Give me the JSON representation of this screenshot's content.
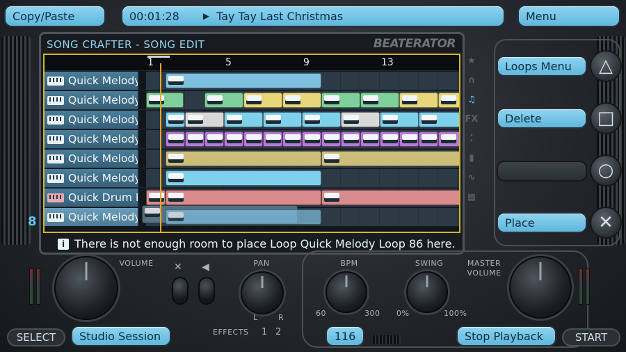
{
  "top_bar": {
    "left_button": "Copy/Paste",
    "time": "00:01:28",
    "play_glyph": "▶",
    "song_title": "Tay Tay Last Christmas",
    "menu_button": "Menu"
  },
  "screen": {
    "title": "SONG CRAFTER - SONG EDIT",
    "brand": "BEATERATOR",
    "ruler": [
      "1",
      "5",
      "9",
      "13"
    ],
    "tracks": [
      {
        "label": "Quick Melody",
        "icon": "keyboard-icon"
      },
      {
        "label": "Quick Melody",
        "icon": "keyboard-icon"
      },
      {
        "label": "Quick Melody",
        "icon": "keyboard-icon"
      },
      {
        "label": "Quick Melody",
        "icon": "keyboard-icon"
      },
      {
        "label": "Quick Melody",
        "icon": "keyboard-icon"
      },
      {
        "label": "Quick Melody",
        "icon": "keyboard-icon"
      },
      {
        "label": "Quick Drum L",
        "icon": "drum-icon"
      },
      {
        "label": "Quick Melody",
        "icon": "keyboard-icon"
      }
    ],
    "message_icon": "i",
    "message": "There is not enough room to place Loop Quick Melody Loop 86 here.",
    "side_icons": [
      "star-icon",
      "headphones-icon",
      "music-note-icon",
      "fx-icon",
      "dots-icon",
      "bars-icon",
      "wave-icon",
      "grid-icon",
      "grid-icon"
    ],
    "side_labels": {
      "fx": "FX"
    },
    "row_marker": "8"
  },
  "actions": {
    "loops_menu": "Loops Menu",
    "delete": "Delete",
    "empty": "",
    "place": "Place"
  },
  "controls": {
    "volume": "VOLUME",
    "pan": "PAN",
    "pan_l": "L",
    "pan_r": "R",
    "effects": "EFFECTS",
    "effect_1": "1",
    "effect_2": "2",
    "bpm": "BPM",
    "bpm_min": "60",
    "bpm_max": "300",
    "swing": "SWING",
    "swing_min": "0%",
    "swing_max": "100%",
    "master_volume_1": "MASTER",
    "master_volume_2": "VOLUME"
  },
  "bottom_bar": {
    "select": "SELECT",
    "session": "Studio Session",
    "bpm_value": "116",
    "stop": "Stop Playback",
    "start": "START"
  },
  "colors": {
    "accent_blue": "#5eb7dd",
    "highlight_yellow": "#d5b52b",
    "playhead": "#f5a623",
    "loop_green": "#7fcf9a",
    "loop_yellow": "#e8d67a",
    "loop_purple": "#b77ad6",
    "loop_sand": "#cdbd7b",
    "loop_cyan": "#7fd0ea",
    "loop_salmon": "#d98a8a"
  }
}
